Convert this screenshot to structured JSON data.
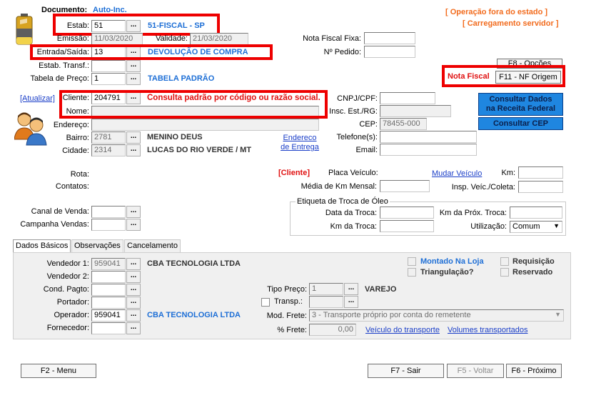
{
  "header": {
    "documento_label": "Documento:",
    "documento_value": "Auto-Inc.",
    "operacao_fora": "[ Operação fora do estado ]",
    "carregamento": "[ Carregamento servidor ]"
  },
  "estab": {
    "label": "Estab:",
    "value": "51",
    "desc": "51-FISCAL - SP"
  },
  "emissao": {
    "label": "Emissão:",
    "value": "11/03/2020"
  },
  "validade": {
    "label": "Validade:",
    "value": "21/03/2020"
  },
  "entrada_saida": {
    "label": "Entrada/Saída:",
    "value": "13",
    "desc": "DEVOLUÇÃO DE COMPRA"
  },
  "estab_transf": {
    "label": "Estab. Transf.:",
    "value": ""
  },
  "tabela_preco": {
    "label": "Tabela de Preço:",
    "value": "1",
    "desc": "TABELA PADRÃO"
  },
  "nota_fiscal_fixa": {
    "label": "Nota Fiscal Fixa:",
    "value": ""
  },
  "pedido": {
    "label": "Nº Pedido:",
    "value": ""
  },
  "f8_opcoes": "F8 - Opções",
  "nota_fiscal": {
    "label": "Nota Fiscal",
    "button": "F11 - NF Origem"
  },
  "atualizar": "[Atualizar]",
  "cliente": {
    "label": "Cliente:",
    "value": "204791",
    "hint": "Consulta padrão por código ou razão social."
  },
  "nome": {
    "label": "Nome:",
    "value": ""
  },
  "endereco": {
    "label": "Endereço:",
    "value": ""
  },
  "bairro": {
    "label": "Bairro:",
    "value": "2781",
    "desc": "MENINO DEUS"
  },
  "cidade": {
    "label": "Cidade:",
    "value": "2314",
    "desc": "LUCAS DO RIO VERDE / MT"
  },
  "endereco_entrega": {
    "line1": "Endereco",
    "line2": "de Entrega"
  },
  "cnpj": {
    "label": "CNPJ/CPF:",
    "value": ""
  },
  "insc_est": {
    "label": "Insc. Est./RG:",
    "value": ""
  },
  "cep": {
    "label": "CEP:",
    "value": "78455-000"
  },
  "telefones": {
    "label": "Telefone(s):",
    "value": ""
  },
  "email": {
    "label": "Email:",
    "value": ""
  },
  "consultar_receita": {
    "line1": "Consultar Dados",
    "line2": "na Receita Federal"
  },
  "consultar_cep": "Consultar CEP",
  "rota_label": "Rota:",
  "contatos_label": "Contatos:",
  "cliente_tag": "[Cliente]",
  "placa": {
    "label": "Placa Veículo:"
  },
  "mudar_veiculo": "Mudar Veículo",
  "km": {
    "label": "Km:",
    "value": ""
  },
  "media_km": {
    "label": "Média de Km Mensal:",
    "value": ""
  },
  "insp_veic": {
    "label": "Insp. Veíc./Coleta:",
    "value": ""
  },
  "etiqueta": {
    "legend": "Etiqueta de Troca de Óleo",
    "data_troca": "Data da Troca:",
    "km_prox": "Km da Próx. Troca:",
    "km_troca": "Km da Troca:",
    "utilizacao": "Utilização:",
    "utilizacao_value": "Comum"
  },
  "canal_venda": {
    "label": "Canal de Venda:",
    "value": ""
  },
  "campanha_vendas": {
    "label": "Campanha Vendas:",
    "value": ""
  },
  "tabs": [
    {
      "label": "Dados Básicos"
    },
    {
      "label": "Observações"
    },
    {
      "label": "Cancelamento"
    }
  ],
  "vendedor1": {
    "label": "Vendedor 1:",
    "value": "959041",
    "desc": "CBA TECNOLOGIA LTDA"
  },
  "vendedor2": {
    "label": "Vendedor 2:",
    "value": ""
  },
  "cond_pagto": {
    "label": "Cond. Pagto:",
    "value": ""
  },
  "portador": {
    "label": "Portador:",
    "value": ""
  },
  "operador": {
    "label": "Operador:",
    "value": "959041",
    "desc": "CBA TECNOLOGIA LTDA"
  },
  "fornecedor": {
    "label": "Fornecedor:",
    "value": ""
  },
  "montado_loja": "Montado Na Loja",
  "triangulacao": "Triangulação?",
  "requisicao": "Requisição",
  "reservado": "Reservado",
  "tipo_preco": {
    "label": "Tipo Preço:",
    "value": "1",
    "desc": "VAREJO"
  },
  "transp": {
    "label": "Transp.:",
    "value": ""
  },
  "mod_frete": {
    "label": "Mod. Frete:",
    "value": "3 - Transporte próprio por conta do remetente"
  },
  "perc_frete": {
    "label": "% Frete:",
    "value": "0,00"
  },
  "veiculo_transporte": "Veículo do transporte",
  "volumes_transportados": "Volumes transportados",
  "footer": {
    "f2": "F2 - Menu",
    "f7": "F7 - Sair",
    "f5": "F5 - Voltar",
    "f6": "F6 - Próximo"
  },
  "colors": {
    "accent_blue": "#1e6fd6",
    "warning_orange": "#f26b1d",
    "highlight_red": "#ee0000",
    "button_blue": "#1f86e0"
  }
}
